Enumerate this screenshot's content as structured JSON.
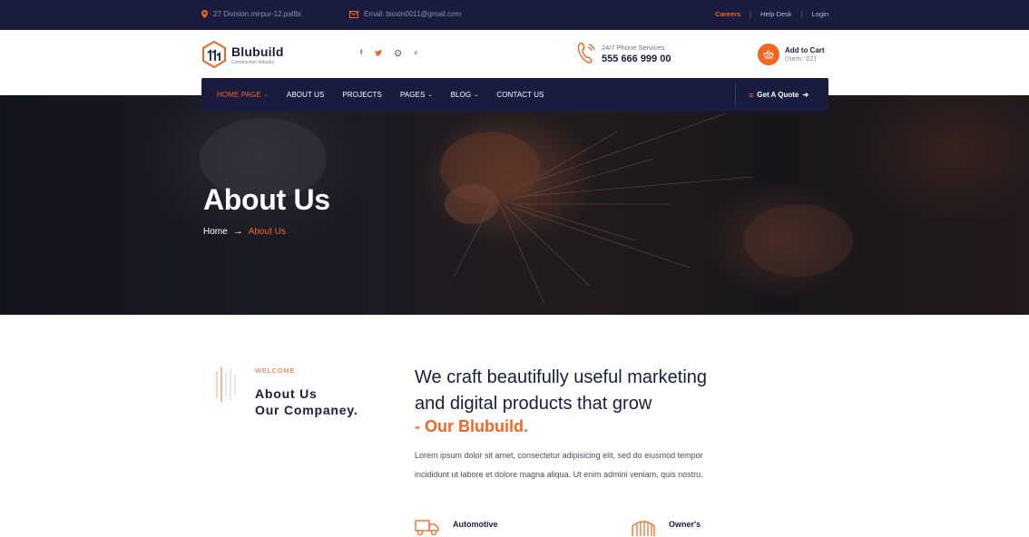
{
  "topbar": {
    "address": "27 Division.mirpur-12.pallbi.",
    "email": "Email: bioxin0011@gmail.com",
    "links": [
      "Careers",
      "Help Desk",
      "Login"
    ]
  },
  "header": {
    "brand": "Blubuild",
    "brand_sub": "Construction Industry",
    "socials": [
      "f",
      "t",
      "s",
      "v"
    ],
    "phone_label": "24/7 Phone Services",
    "phone_number": "555 666 999 00",
    "cart_title": "Add to Cart",
    "cart_items": "(Item: 02)"
  },
  "nav": {
    "items": [
      {
        "label": "HOME PAGE",
        "dropdown": true,
        "active": true
      },
      {
        "label": "ABOUT US",
        "dropdown": false,
        "active": false
      },
      {
        "label": "PROJECTS",
        "dropdown": false,
        "active": false
      },
      {
        "label": "PAGES",
        "dropdown": true,
        "active": false
      },
      {
        "label": "BLOG",
        "dropdown": true,
        "active": false
      },
      {
        "label": "CONTACT US",
        "dropdown": false,
        "active": false
      }
    ],
    "quote_label": "Get A Quote"
  },
  "hero": {
    "title": "About Us",
    "breadcrumb_home": "Home",
    "breadcrumb_current": "About Us"
  },
  "about": {
    "eyebrow": "WELCOME",
    "heading_line1": "About Us",
    "heading_line2": "Our Companey.",
    "tagline_line1": "We craft beautifully useful marketing",
    "tagline_line2": "and digital products that grow",
    "tagline_accent": "- Our Blubuild.",
    "body": "Lorem ipsum dolor sit amet, consectetur adipisicing elit, sed do eiusmod tempor incididunt ut labore et dolore magna aliqua. Ut enim admini veniam, quis nostru.",
    "features": [
      "Automotive",
      "Owner's"
    ]
  },
  "colors": {
    "accent": "#f26522",
    "navy": "#1a1c3f"
  }
}
